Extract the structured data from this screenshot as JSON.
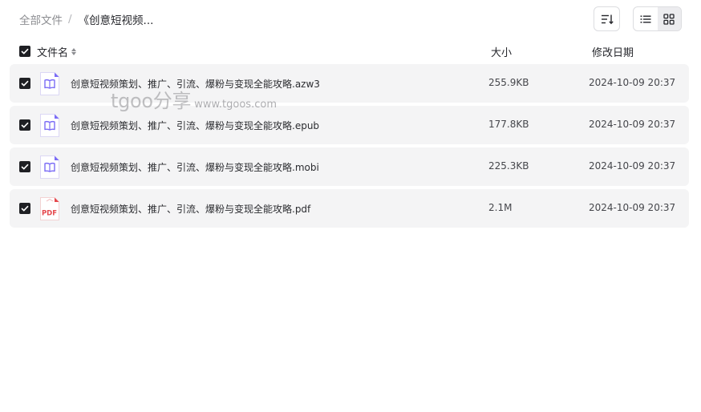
{
  "breadcrumb": {
    "root": "全部文件",
    "separator": "/",
    "current": "《创意短视频..."
  },
  "toolbar": {
    "sort_icon": "sort-list-icon",
    "list_view_icon": "list-view-icon",
    "grid_view_icon": "grid-view-icon",
    "active_view": "grid"
  },
  "columns": {
    "name": "文件名",
    "size": "大小",
    "date": "修改日期"
  },
  "files": [
    {
      "name": "创意短视频策划、推广、引流、爆粉与变现全能攻略.azw3",
      "size": "255.9KB",
      "date": "2024-10-09 20:37",
      "icon": "ebook-file-icon",
      "checked": true
    },
    {
      "name": "创意短视频策划、推广、引流、爆粉与变现全能攻略.epub",
      "size": "177.8KB",
      "date": "2024-10-09 20:37",
      "icon": "ebook-file-icon",
      "checked": true
    },
    {
      "name": "创意短视频策划、推广、引流、爆粉与变现全能攻略.mobi",
      "size": "225.3KB",
      "date": "2024-10-09 20:37",
      "icon": "ebook-file-icon",
      "checked": true
    },
    {
      "name": "创意短视频策划、推广、引流、爆粉与变现全能攻略.pdf",
      "size": "2.1M",
      "date": "2024-10-09 20:37",
      "icon": "pdf-file-icon",
      "pdf_label": "PDF",
      "checked": true
    }
  ],
  "watermark": {
    "main": "tgoo分享",
    "url": "www.tgoos.com"
  },
  "colors": {
    "ebook_accent": "#7b6cf6",
    "pdf_accent": "#e5484d",
    "row_background": "#f4f4f5",
    "checkbox": "#1f2024"
  }
}
